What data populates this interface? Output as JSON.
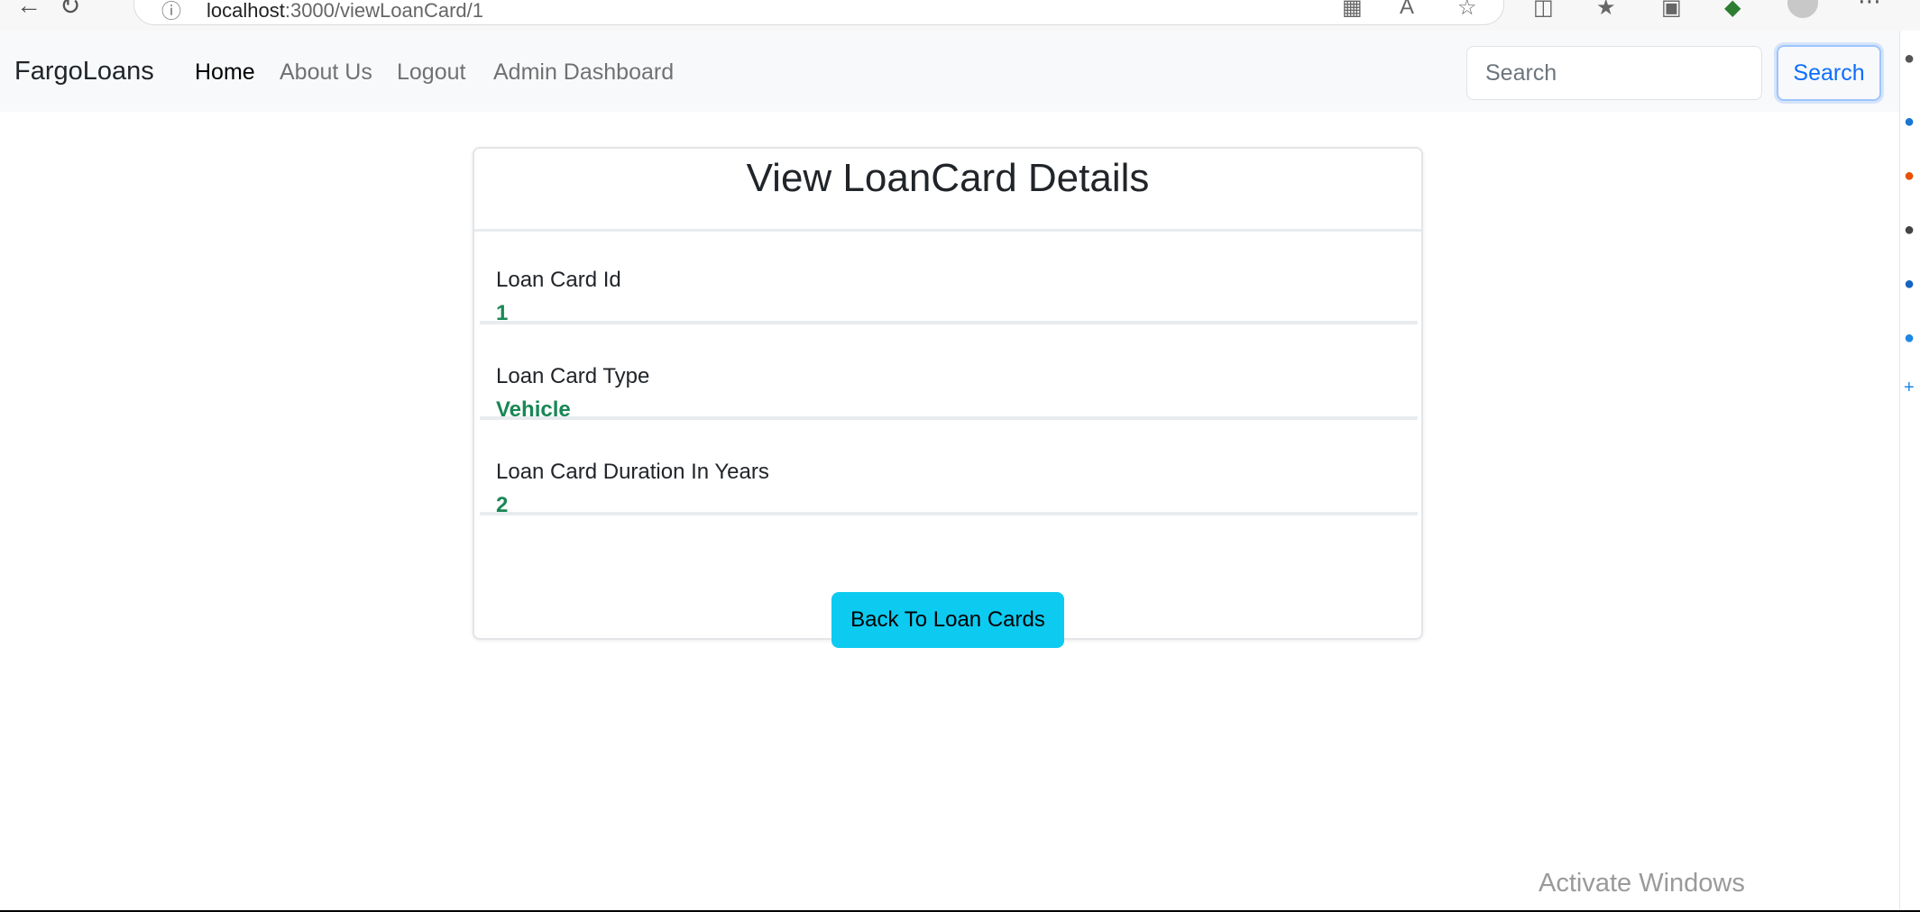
{
  "browser": {
    "address_host": "localhost",
    "address_path": ":3000/viewLoanCard/1"
  },
  "navbar": {
    "brand": "FargoLoans",
    "links": [
      "Home",
      "About Us",
      "Logout",
      "Admin Dashboard"
    ],
    "active_link": "Home",
    "search_placeholder": "Search",
    "search_button": "Search"
  },
  "card": {
    "title": "View LoanCard Details",
    "items": [
      {
        "label": "Loan Card Id",
        "value": "1"
      },
      {
        "label": "Loan Card Type",
        "value": "Vehicle"
      },
      {
        "label": "Loan Card Duration In Years",
        "value": "2"
      }
    ],
    "back_button": "Back To Loan Cards"
  },
  "watermark": "Activate Windows",
  "colors": {
    "value_green": "#198754",
    "info_button": "#0dcaf0",
    "primary": "#0d6efd",
    "navbar_bg": "#f8f9fa"
  }
}
